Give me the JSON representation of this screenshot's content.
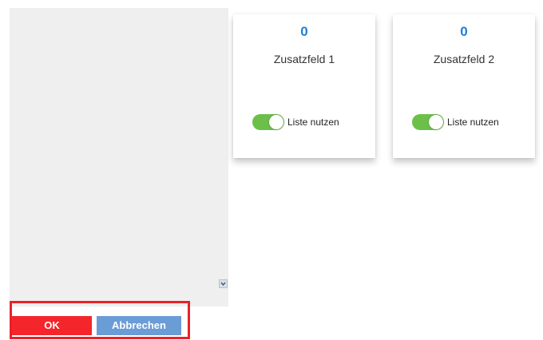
{
  "cards": [
    {
      "count": "0",
      "title": "Zusatzfeld 1",
      "toggle_label": "Liste nutzen",
      "toggle_on": true
    },
    {
      "count": "0",
      "title": "Zusatzfeld 2",
      "toggle_label": "Liste nutzen",
      "toggle_on": true
    }
  ],
  "buttons": {
    "ok_label": "OK",
    "cancel_label": "Abbrechen"
  },
  "colors": {
    "count_blue": "#1f7fd6",
    "toggle_green": "#6cc04a",
    "ok_red": "#f4262b",
    "cancel_blue": "#6a9cd6",
    "highlight_red": "#e8222a"
  },
  "icons": {
    "scroll": "chevron-down-icon"
  }
}
